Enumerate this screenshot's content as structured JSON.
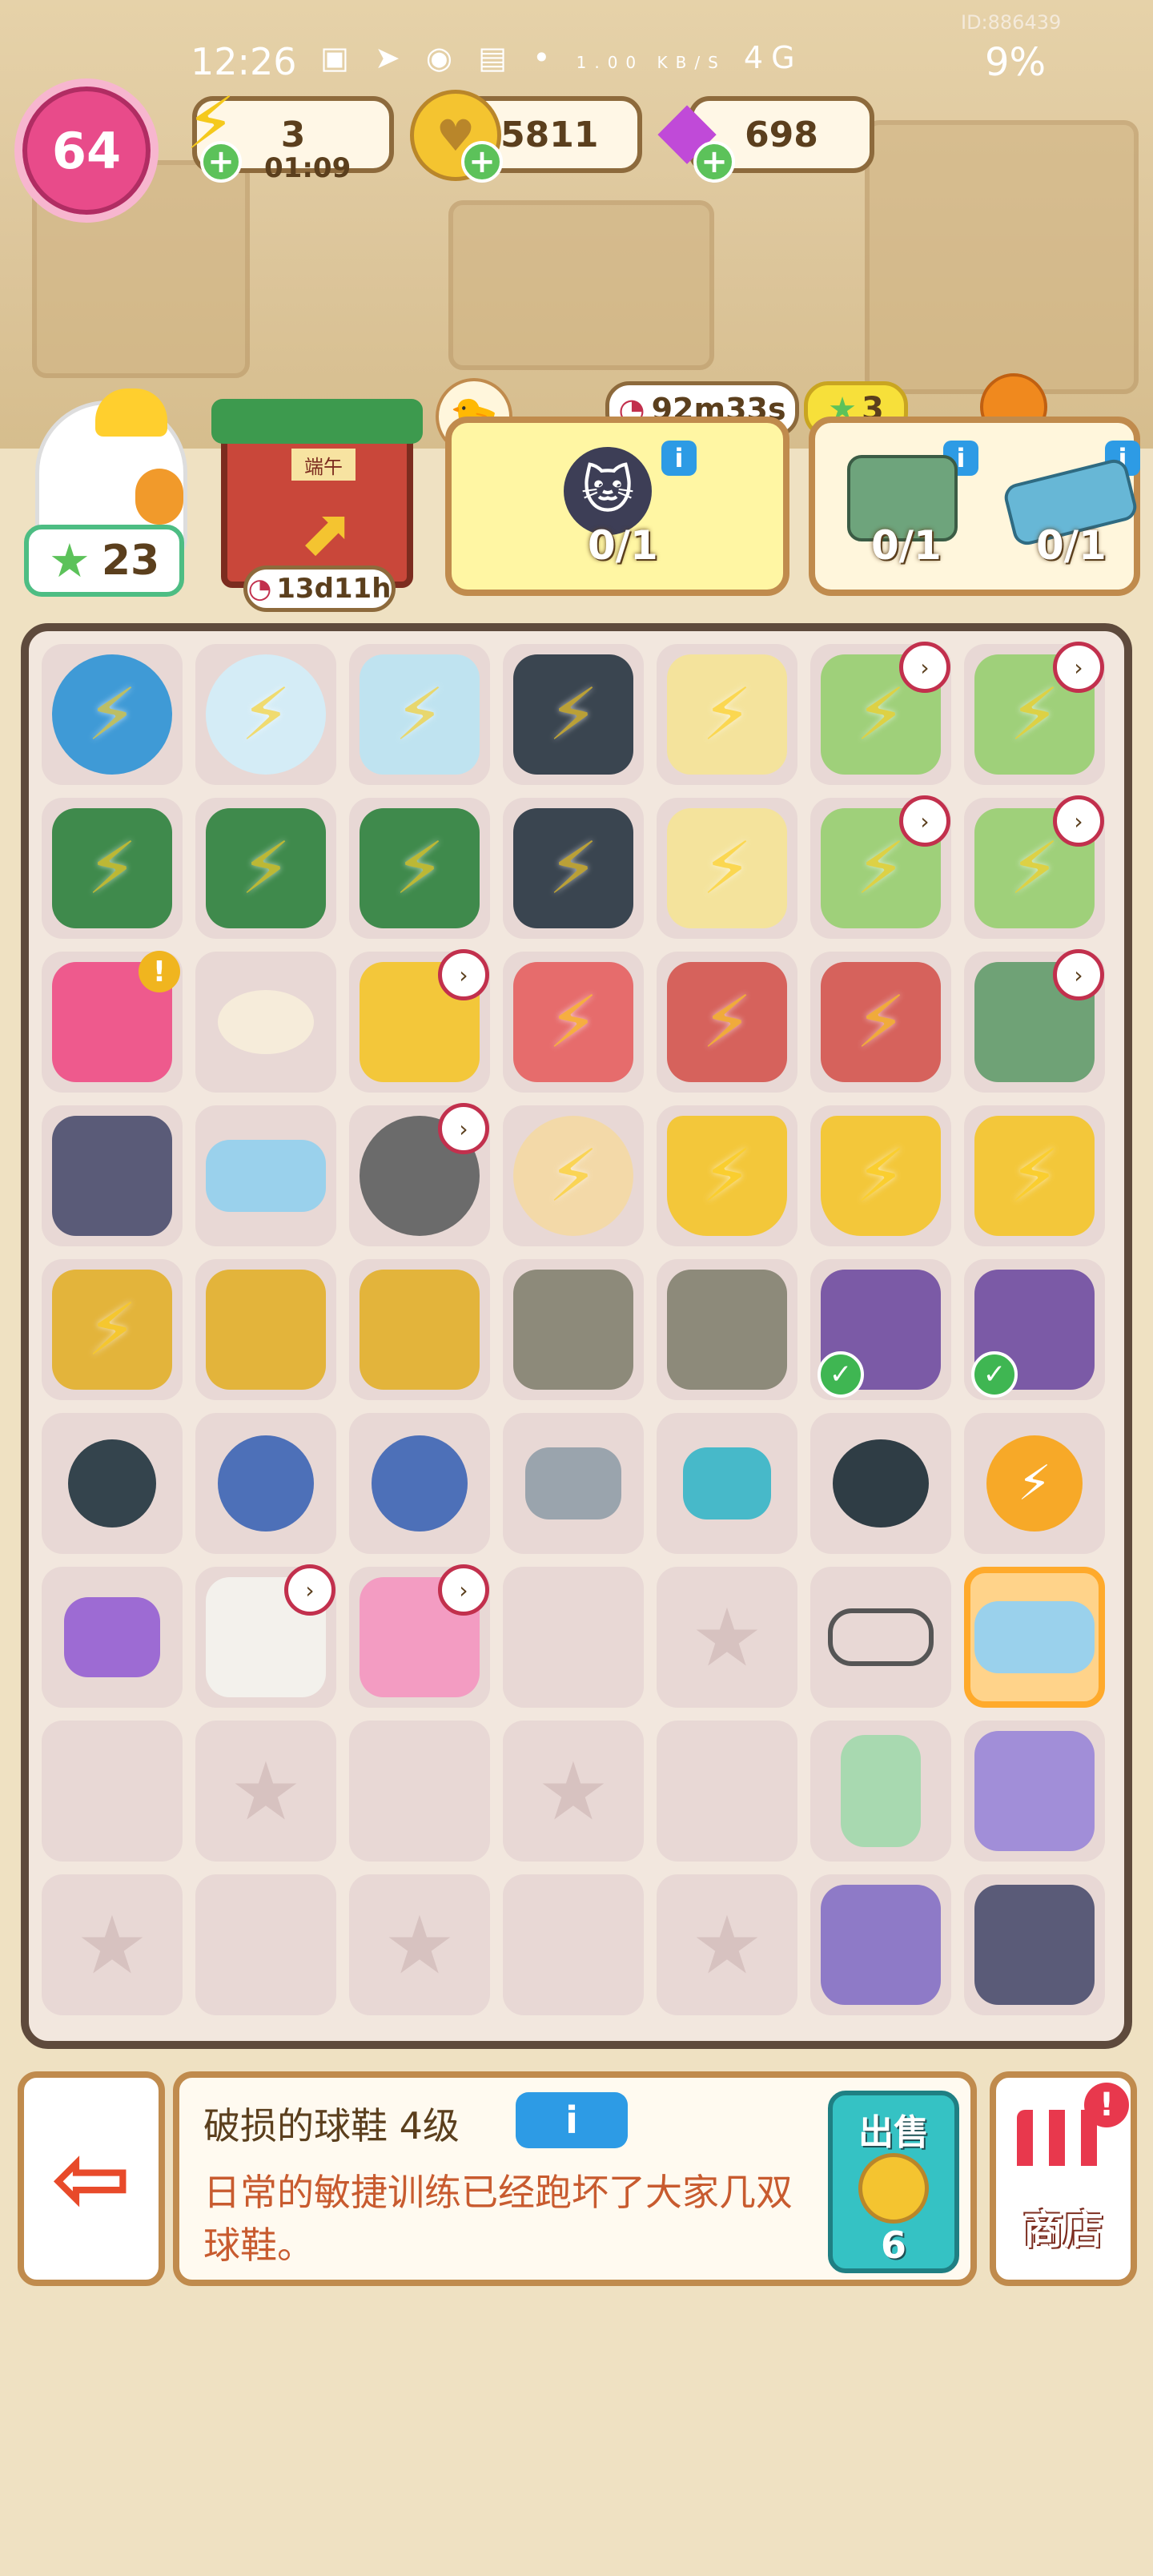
{
  "status_bar": {
    "time": "12:26",
    "id_text": "ID:886439",
    "network_speed": "1.00 KB/S",
    "network_type": "4G",
    "battery": "9%"
  },
  "resources": {
    "level": "64",
    "energy": "3",
    "energy_timer": "01:09",
    "coins": "45811",
    "gems": "698"
  },
  "player": {
    "stars": "23"
  },
  "event": {
    "timer": "13d11h",
    "sign_text": "端午"
  },
  "quests": {
    "quest_timer": "92m33s",
    "quest_1_progress": "0/1",
    "reward_stars": "3",
    "quest_2_progress_a": "0/1",
    "quest_2_progress_b": "0/1"
  },
  "info_panel": {
    "item_name": "破损的球鞋 4级",
    "info_label": "i",
    "description": "日常的敏捷训练已经跑坏了大家几双球鞋。",
    "sell_label": "出售",
    "sell_price": "6"
  },
  "buttons": {
    "shop_label": "商店"
  },
  "colors": {
    "accent": "#e84b8a",
    "frame": "#c08b4d",
    "sell_teal": "#35c2c4",
    "selected": "#ffaa2b"
  }
}
